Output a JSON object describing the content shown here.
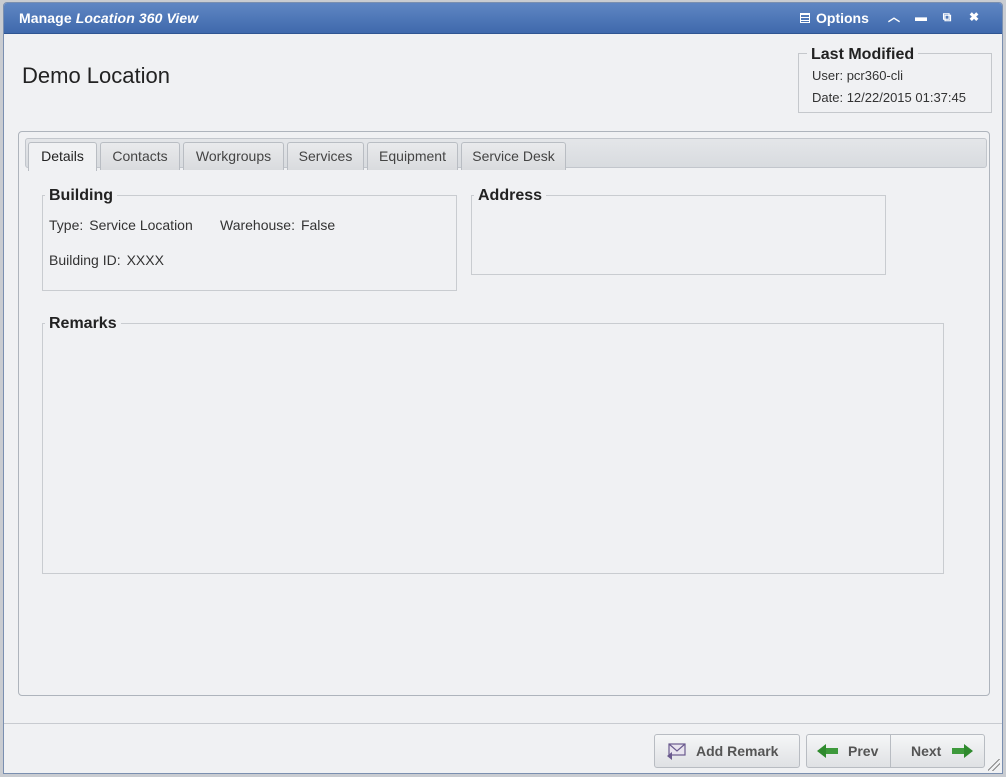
{
  "window": {
    "title_prefix": "Manage",
    "title_italic": "Location 360 View",
    "options_label": "Options",
    "controls": [
      "collapse-icon",
      "minimize-icon",
      "popout-icon",
      "close-icon"
    ]
  },
  "page": {
    "title": "Demo Location"
  },
  "last_modified": {
    "legend": "Last Modified",
    "user_label": "User:",
    "user_value": "pcr360-cli",
    "date_label": "Date:",
    "date_value": "12/22/2015 01:37:45"
  },
  "tabs": [
    "Details",
    "Contacts",
    "Workgroups",
    "Services",
    "Equipment",
    "Service Desk"
  ],
  "active_tab": "Details",
  "building": {
    "legend": "Building",
    "type_label": "Type:",
    "type_value": "Service Location",
    "warehouse_label": "Warehouse:",
    "warehouse_value": "False",
    "id_label": "Building ID:",
    "id_value": "XXXX"
  },
  "address": {
    "legend": "Address"
  },
  "remarks": {
    "legend": "Remarks"
  },
  "footer": {
    "add_remark": "Add Remark",
    "prev": "Prev",
    "next": "Next"
  },
  "colors": {
    "titlebar": "#4a74b6",
    "accent_green": "#3e9a3c"
  }
}
